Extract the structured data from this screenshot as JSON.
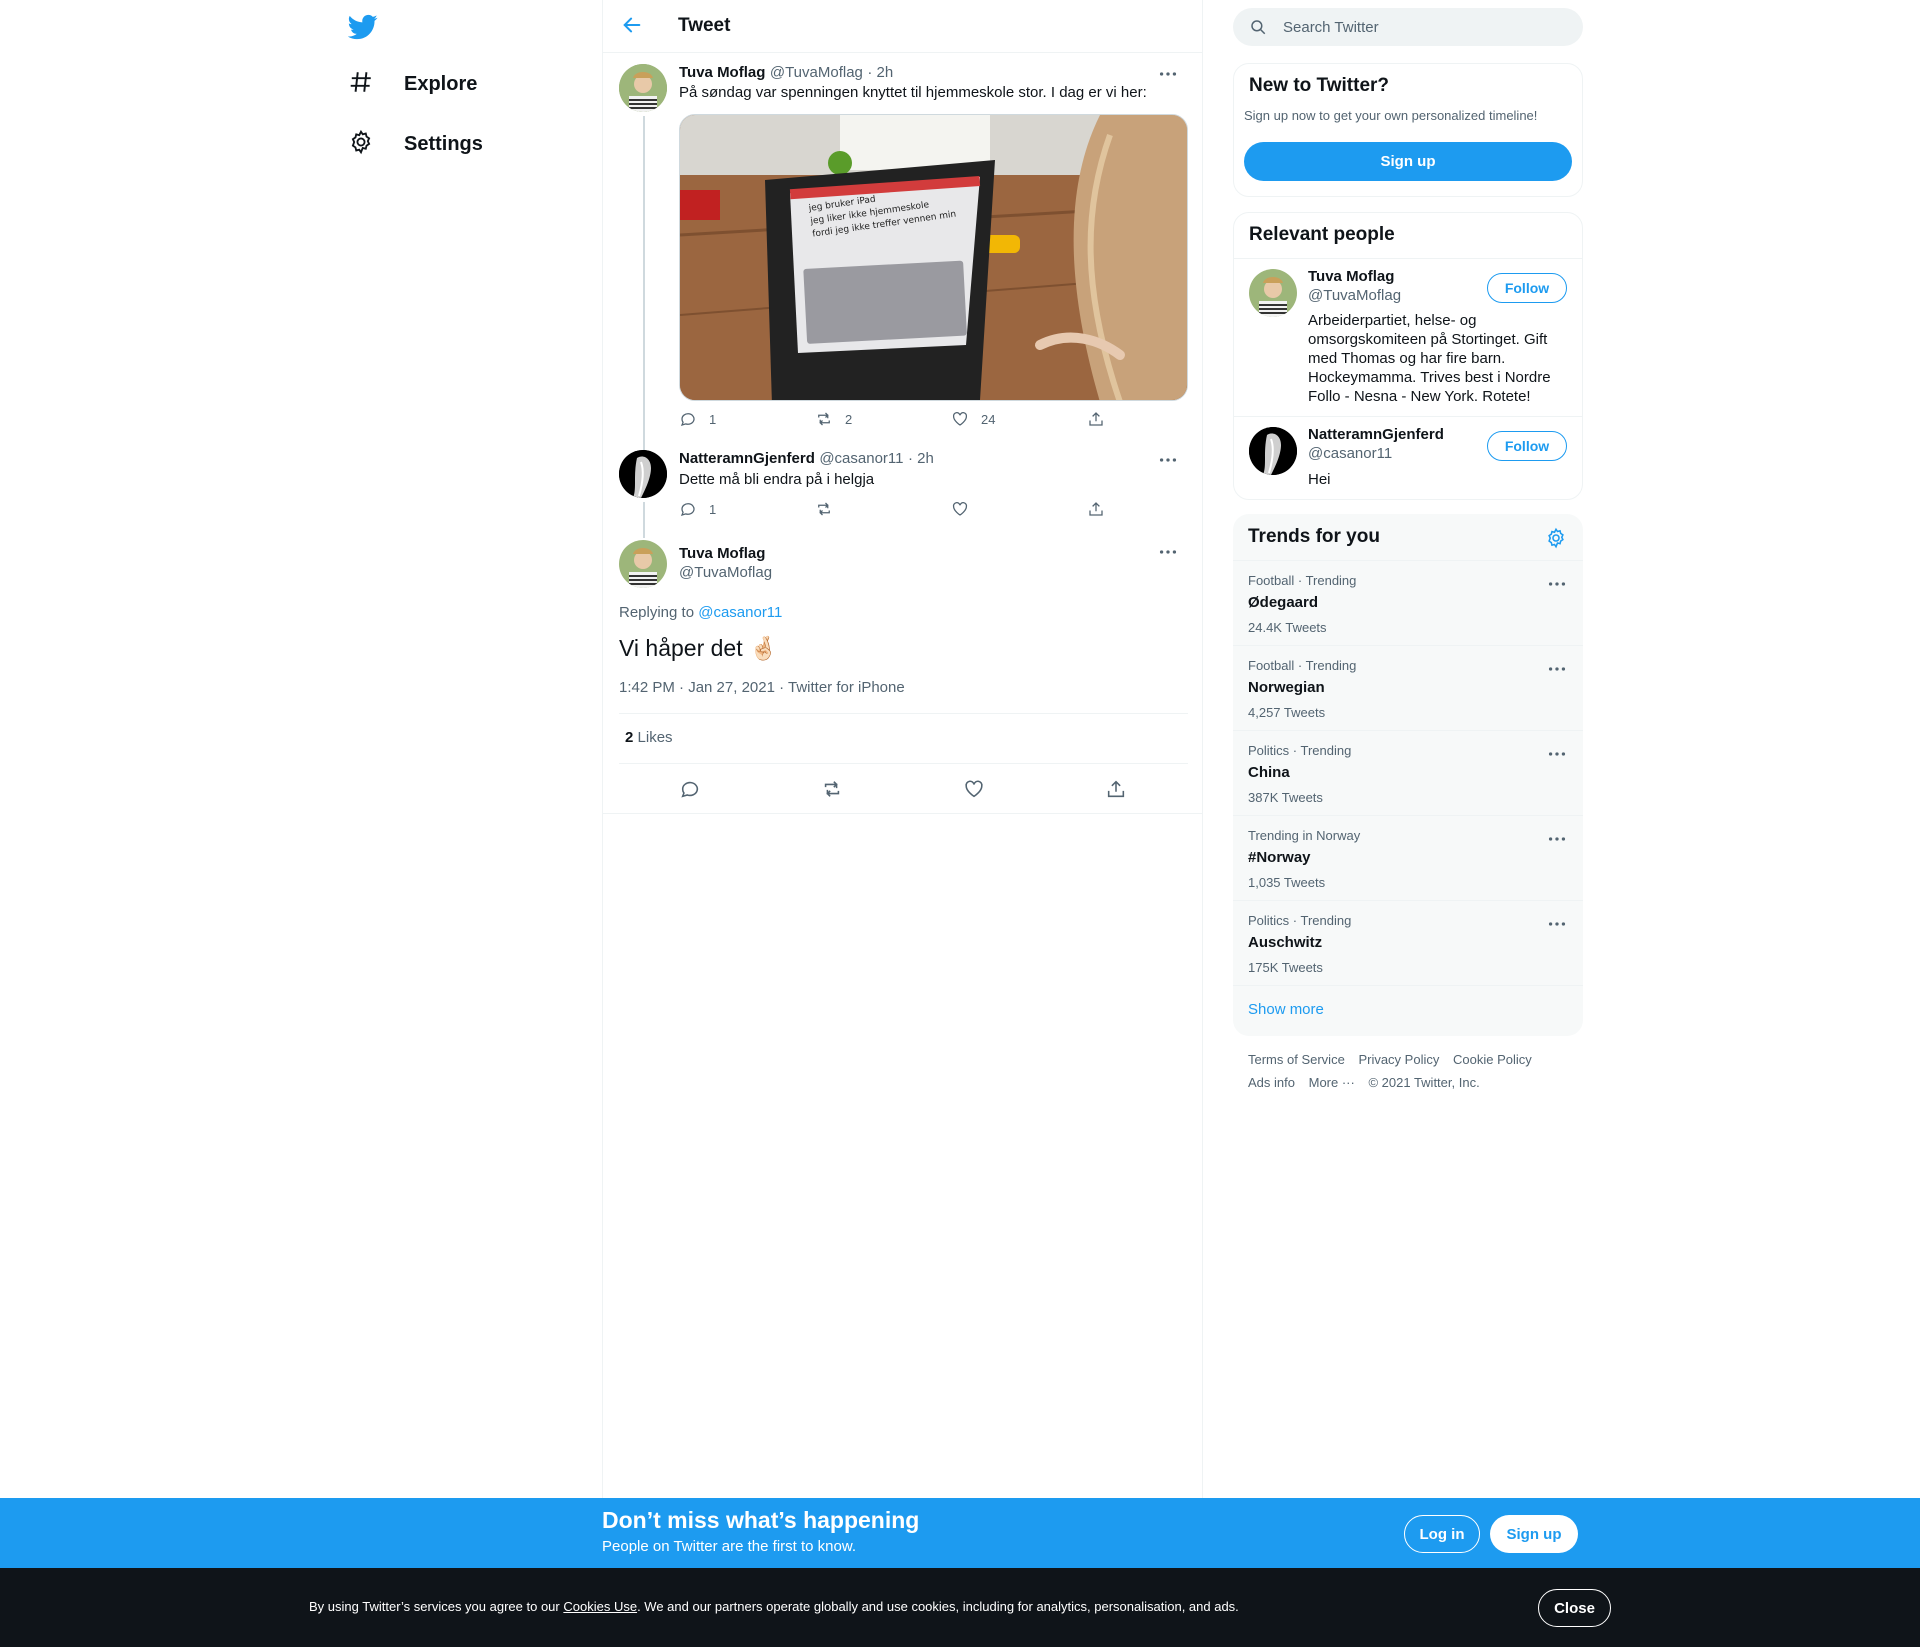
{
  "nav": {
    "logo": "twitter-bird-icon",
    "items": [
      {
        "label": "Explore",
        "icon": "hashtag-icon"
      },
      {
        "label": "Settings",
        "icon": "gear-icon"
      }
    ]
  },
  "header": {
    "title": "Tweet"
  },
  "thread": [
    {
      "name": "Tuva Moflag",
      "handle": "@TuvaMoflag",
      "time": "· 2h",
      "text": "På søndag var spenningen knyttet til hjemmeskole stor. I dag er vi her:",
      "image_text": [
        "jeg bruker iPad",
        "jeg liker ikke hjemmeskole",
        "fordi jeg ikke treffer vennen min"
      ],
      "replies": "1",
      "retweets": "2",
      "likes": "24"
    },
    {
      "name": "NatteramnGjenferd",
      "handle": "@casanor11",
      "time": "· 2h",
      "text": "Dette må bli endra på i helgja",
      "replies": "1",
      "retweets": "",
      "likes": ""
    }
  ],
  "focus": {
    "name": "Tuva Moflag",
    "handle": "@TuvaMoflag",
    "replying_prefix": "Replying to",
    "replying_to": "@casanor11",
    "text": "Vi håper det",
    "emoji": "🤞🏻",
    "timestamp": "1:42 PM · Jan 27, 2021 · Twitter for iPhone",
    "likes_count": "2",
    "likes_label": "Likes"
  },
  "search": {
    "placeholder": "Search Twitter"
  },
  "new_to_twitter": {
    "title": "New to Twitter?",
    "subtitle": "Sign up now to get your own personalized timeline!",
    "button": "Sign up"
  },
  "relevant_people": {
    "title": "Relevant people",
    "people": [
      {
        "name": "Tuva Moflag",
        "handle": "@TuvaMoflag",
        "follow": "Follow",
        "bio": "Arbeiderpartiet, helse- og omsorgskomiteen på Stortinget. Gift med Thomas og har fire barn. Hockeymamma. Trives best i Nordre Follo - Nesna - New York. Rotete!"
      },
      {
        "name": "NatteramnGjenferd",
        "handle": "@casanor11",
        "follow": "Follow",
        "bio": "Hei"
      }
    ]
  },
  "trends": {
    "title": "Trends for you",
    "items": [
      {
        "meta": "Football · Trending",
        "name": "Ødegaard",
        "count": "24.4K Tweets"
      },
      {
        "meta": "Football · Trending",
        "name": "Norwegian",
        "count": "4,257 Tweets"
      },
      {
        "meta": "Politics · Trending",
        "name": "China",
        "count": "387K Tweets"
      },
      {
        "meta": "Trending in Norway",
        "name": "#Norway",
        "count": "1,035 Tweets"
      },
      {
        "meta": "Politics · Trending",
        "name": "Auschwitz",
        "count": "175K Tweets"
      }
    ],
    "show_more": "Show more"
  },
  "footer": {
    "links_row1": [
      "Terms of Service",
      "Privacy Policy",
      "Cookie Policy"
    ],
    "links_row2": [
      "Ads info",
      "More ···",
      "© 2021 Twitter, Inc."
    ]
  },
  "banner": {
    "title": "Don’t miss what’s happening",
    "subtitle": "People on Twitter are the first to know.",
    "login": "Log in",
    "signup": "Sign up"
  },
  "cookie": {
    "text_before": "By using Twitter’s services you agree to our ",
    "link": "Cookies Use",
    "text_after": ". We and our partners operate globally and use cookies, including for analytics, personalisation, and ads.",
    "close": "Close"
  },
  "colors": {
    "accent": "#1d9bf0",
    "text": "#0f1419",
    "muted": "#536471",
    "dark": "#0f1419"
  }
}
